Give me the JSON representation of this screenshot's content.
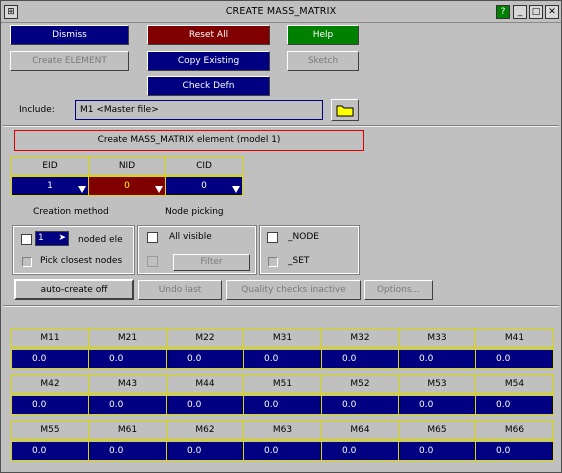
{
  "window": {
    "title": "CREATE MASS_MATRIX",
    "help_glyph": "?",
    "minimize_glyph": "_",
    "maximize_glyph": "□",
    "close_glyph": "✕",
    "menu_glyph": "⊞"
  },
  "toolbar": {
    "dismiss": "Dismiss",
    "reset_all": "Reset All",
    "help": "Help",
    "create_element": "Create ELEMENT",
    "copy_existing": "Copy Existing",
    "sketch": "Sketch",
    "check_defn": "Check Defn"
  },
  "include": {
    "label": "Include:",
    "value": "M1  <Master file>"
  },
  "element": {
    "create_label": "Create MASS_MATRIX element (model 1)",
    "headers": [
      "EID",
      "NID",
      "CID"
    ],
    "values": [
      "1",
      "0",
      "0"
    ]
  },
  "creation": {
    "method_label": "Creation method",
    "picking_label": "Node picking",
    "noded_count": "1",
    "noded_label": "noded ele",
    "pick_closest": "Pick closest nodes",
    "all_visible": "All visible",
    "filter": "Filter",
    "node": "_NODE",
    "set": "_SET"
  },
  "actions": {
    "auto_create": "auto-create off",
    "undo_last": "Undo last",
    "quality_checks": "Quality checks inactive",
    "options": "Options..."
  },
  "matrix": {
    "rows": [
      {
        "headers": [
          "M11",
          "M21",
          "M22",
          "M31",
          "M32",
          "M33",
          "M41"
        ],
        "values": [
          "0.0",
          "0.0",
          "0.0",
          "0.0",
          "0.0",
          "0.0",
          "0.0"
        ]
      },
      {
        "headers": [
          "M42",
          "M43",
          "M44",
          "M51",
          "M52",
          "M53",
          "M54"
        ],
        "values": [
          "0.0",
          "0.0",
          "0.0",
          "0.0",
          "0.0",
          "0.0",
          "0.0"
        ]
      },
      {
        "headers": [
          "M55",
          "M61",
          "M62",
          "M63",
          "M64",
          "M65",
          "M66"
        ],
        "values": [
          "0.0",
          "0.0",
          "0.0",
          "0.0",
          "0.0",
          "0.0",
          "0.0"
        ]
      }
    ]
  }
}
